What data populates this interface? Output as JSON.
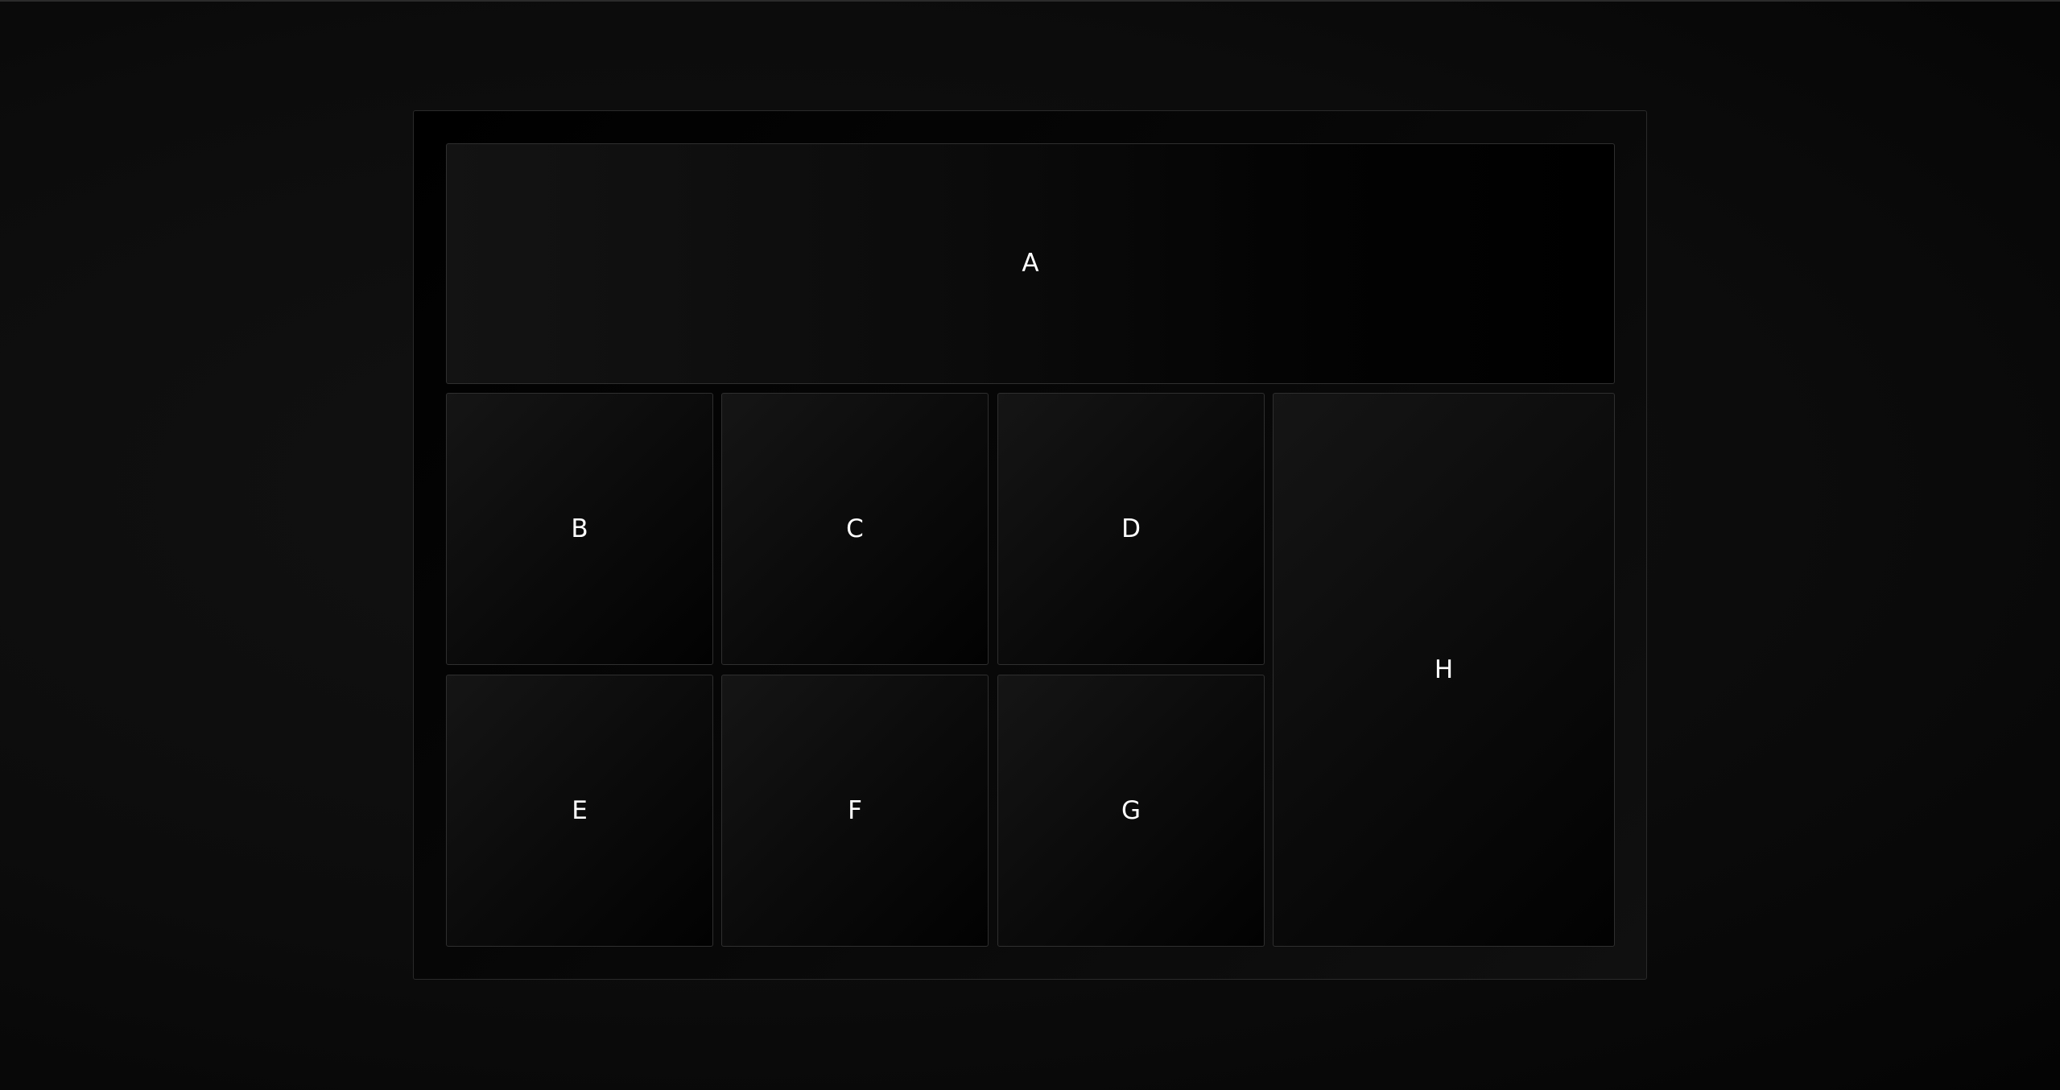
{
  "tiles": {
    "a": "A",
    "b": "B",
    "c": "C",
    "d": "D",
    "e": "E",
    "f": "F",
    "g": "G",
    "h": "H"
  },
  "colors": {
    "label": "#ffffff",
    "tile_border": "#2f2f2f",
    "frame_border": "#2a2a2a",
    "background": "#0c0c0c"
  }
}
